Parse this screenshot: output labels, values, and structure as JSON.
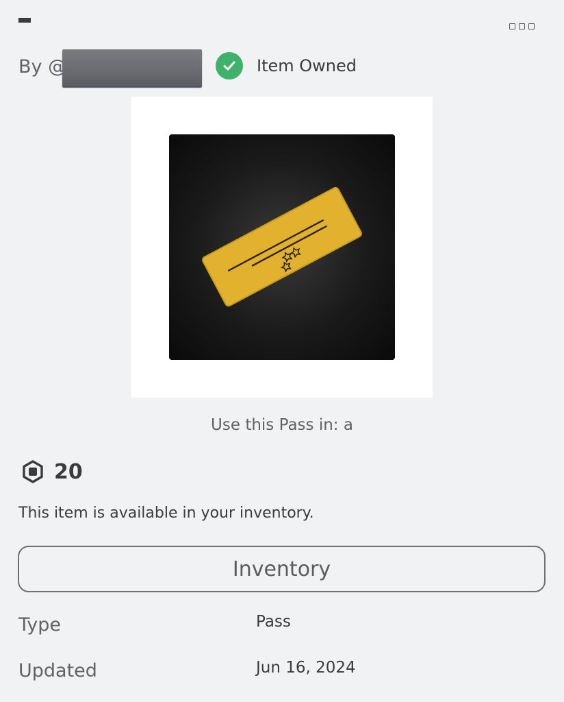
{
  "header": {
    "creator_prefix": "By @",
    "owned_label": "Item Owned",
    "more_icon": "more-options-icon"
  },
  "thumbnail": {
    "icon": "golden-ticket-pass-icon",
    "ticket_color": "#e0b12e",
    "background_color": "#1a1a1a"
  },
  "usage": {
    "text": "Use this Pass in: a"
  },
  "price": {
    "icon": "robux-icon",
    "value": "20"
  },
  "availability": {
    "text": "This item is available in your inventory."
  },
  "actions": {
    "inventory_label": "Inventory"
  },
  "details": [
    {
      "key": "Type",
      "value": "Pass"
    },
    {
      "key": "Updated",
      "value": "Jun 16, 2024"
    }
  ],
  "colors": {
    "owned_check": "#3fb26a",
    "background": "#f1f2f4"
  }
}
